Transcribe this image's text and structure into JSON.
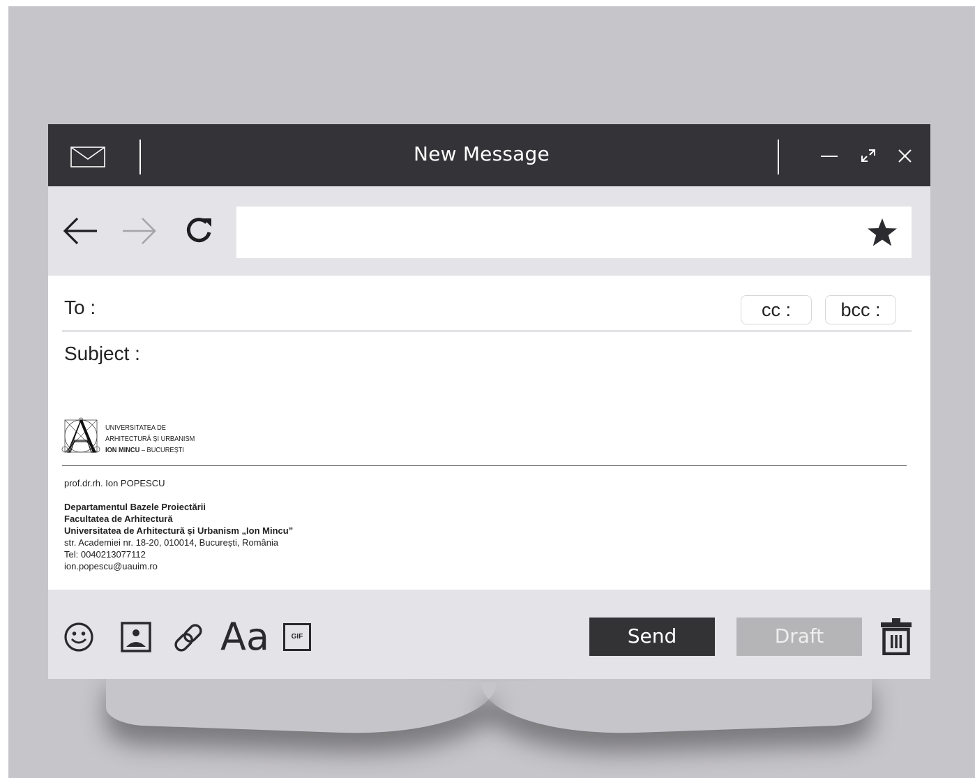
{
  "window": {
    "title": "New Message"
  },
  "compose": {
    "to_label": "To :",
    "cc_label": "cc :",
    "bcc_label": "bcc :",
    "subject_label": "Subject :"
  },
  "signature": {
    "logo_line1": "UNIVERSITATEA DE",
    "logo_line2": "ARHITECTURĂ ȘI URBANISM",
    "logo_line3_bold": "ION MINCU",
    "logo_line3_rest": " – BUCUREȘTI",
    "name": "prof.dr.rh. Ion POPESCU",
    "department": "Departamentul Bazele Proiectării",
    "faculty": "Facultatea de Arhitectură",
    "university": "Universitatea de Arhitectură și Urbanism „Ion Mincu”",
    "address": "str. Academiei nr. 18-20, 010014, București, România",
    "phone": "Tel: 0040213077112",
    "email": "ion.popescu@uauim.ro"
  },
  "toolbar": {
    "font_label": "Aa",
    "gif_label": "GIF",
    "send_label": "Send",
    "draft_label": "Draft"
  },
  "icons": {
    "titlebar": [
      "mail-icon",
      "minimize-icon",
      "expand-icon",
      "close-icon"
    ],
    "navigation": [
      "back-arrow-icon",
      "forward-arrow-icon",
      "refresh-icon",
      "star-icon"
    ],
    "compose_tools": [
      "emoji-icon",
      "image-icon",
      "link-icon",
      "font-icon",
      "gif-icon",
      "trash-icon"
    ]
  },
  "colors": {
    "titlebar": "#343438",
    "toolbar_bg": "#e4e3e8",
    "send_button": "#333336",
    "draft_button": "#b5b5b7",
    "backdrop": "#c6c5ca"
  }
}
